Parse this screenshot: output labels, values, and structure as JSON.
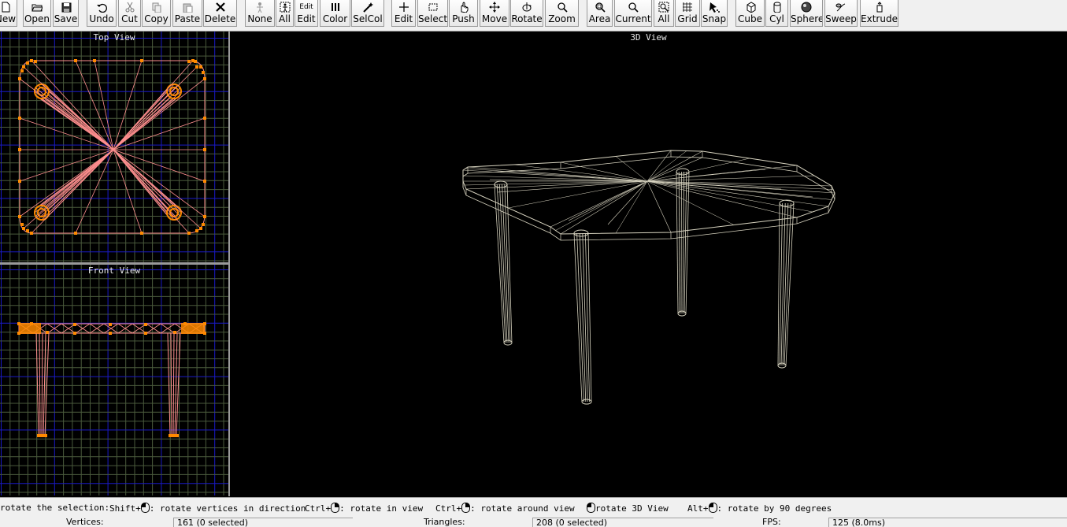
{
  "toolbar": {
    "buttons": [
      {
        "label": "New",
        "icon": "new-file-icon"
      },
      {
        "label": "Open",
        "icon": "open-folder-icon"
      },
      {
        "label": "Save",
        "icon": "save-disk-icon"
      },
      {
        "label": "Undo",
        "icon": "undo-arrow-icon"
      },
      {
        "label": "Cut",
        "icon": "scissors-icon"
      },
      {
        "label": "Copy",
        "icon": "copy-icon"
      },
      {
        "label": "Paste",
        "icon": "paste-icon"
      },
      {
        "label": "Delete",
        "icon": "x-delete-icon"
      },
      {
        "label": "None",
        "icon": "select-none-icon"
      },
      {
        "label": "All",
        "icon": "select-all-icon"
      },
      {
        "label": "Edit",
        "icon": "edit-text-icon",
        "top_text": "Edit"
      },
      {
        "label": "Color",
        "icon": "color-bars-icon"
      },
      {
        "label": "SelCol",
        "icon": "magic-wand-icon"
      },
      {
        "label": "Edit",
        "icon": "plus-icon"
      },
      {
        "label": "Select",
        "icon": "select-rect-icon"
      },
      {
        "label": "Push",
        "icon": "hand-push-icon"
      },
      {
        "label": "Move",
        "icon": "move-arrows-icon"
      },
      {
        "label": "Rotate",
        "icon": "rotate-icon"
      },
      {
        "label": "Zoom",
        "icon": "magnifier-icon"
      },
      {
        "label": "Area",
        "icon": "zoom-area-icon"
      },
      {
        "label": "Current",
        "icon": "zoom-current-icon"
      },
      {
        "label": "All",
        "icon": "zoom-all-icon"
      },
      {
        "label": "Grid",
        "icon": "grid-icon"
      },
      {
        "label": "Snap",
        "icon": "snap-cursor-icon"
      },
      {
        "label": "Cube",
        "icon": "cube-icon"
      },
      {
        "label": "Cyl",
        "icon": "cylinder-icon"
      },
      {
        "label": "Sphere",
        "icon": "sphere-icon"
      },
      {
        "label": "Sweep",
        "icon": "sweep-icon"
      },
      {
        "label": "Extrude",
        "icon": "extrude-icon"
      }
    ]
  },
  "views": {
    "top": {
      "title": "Top View"
    },
    "front": {
      "title": "Front View"
    },
    "three_d": {
      "title": "3D View"
    }
  },
  "colors": {
    "grid_minor": "#4a5a3c",
    "grid_major": "#1a1ac8",
    "mesh_edges": "#ff8f8f",
    "vertices": "#ff8a00",
    "wire_3d": "#d8d4c0",
    "viewport_bg": "#000000"
  },
  "hints": [
    {
      "text": "rotate the selection:",
      "mouse": null
    },
    {
      "prefix": "Shift+",
      "mouse": "left-button-mouse-icon",
      "text": ": rotate vertices in direction"
    },
    {
      "prefix": "Ctrl+",
      "mouse": "right-button-mouse-icon",
      "text": ": rotate in view"
    },
    {
      "prefix": "Ctrl+",
      "mouse": "right-button-mouse-icon",
      "text": ": rotate around view"
    },
    {
      "prefix": "",
      "mouse": "left-button-mouse-icon",
      "text": "rotate 3D View"
    },
    {
      "prefix": "Alt+",
      "mouse": "left-button-mouse-icon",
      "text": ": rotate by 90 degrees"
    }
  ],
  "status": {
    "vertices_label": "Vertices:",
    "vertices_value": "161 (0 selected)",
    "triangles_label": "Triangles:",
    "triangles_value": "208 (0 selected)",
    "fps_label": "FPS:",
    "fps_value": "125 (8.0ms)"
  }
}
